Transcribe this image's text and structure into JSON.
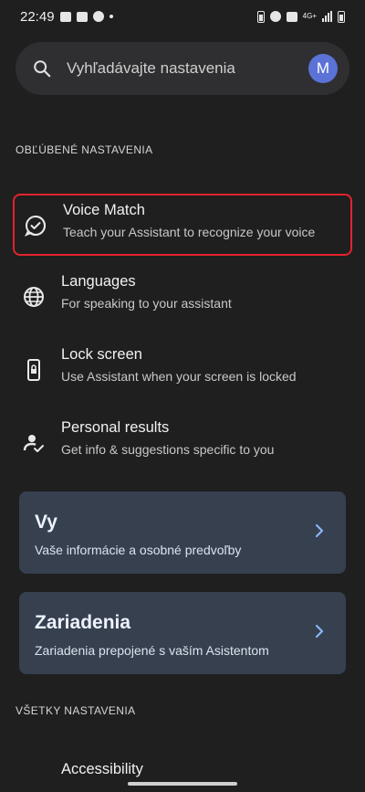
{
  "status_bar": {
    "time": "22:49",
    "network": "4G+"
  },
  "search": {
    "placeholder": "Vyhľadávajte nastavenia",
    "avatar_letter": "M"
  },
  "favorites": {
    "header": "OBĽÚBENÉ NASTAVENIA",
    "items": [
      {
        "title": "Voice Match",
        "subtitle": "Teach your Assistant to recognize your voice",
        "icon": "voice-match-icon"
      },
      {
        "title": "Languages",
        "subtitle": "For speaking to your assistant",
        "icon": "globe-icon"
      },
      {
        "title": "Lock screen",
        "subtitle": "Use Assistant when your screen is locked",
        "icon": "lock-screen-phone-icon"
      },
      {
        "title": "Personal results",
        "subtitle": "Get info & suggestions specific to you",
        "icon": "person-check-icon"
      }
    ]
  },
  "cards": [
    {
      "title": "Vy",
      "subtitle": "Vaše informácie a osobné predvoľby"
    },
    {
      "title": "Zariadenia",
      "subtitle": "Zariadenia prepojené s vaším Asistentom"
    }
  ],
  "all_settings": {
    "header": "VŠETKY NASTAVENIA",
    "first_item": "Accessibility"
  },
  "colors": {
    "background": "#1f1f1f",
    "card": "#36404f",
    "accent_chevron": "#8ab4f8",
    "highlight": "#e2232d",
    "avatar": "#5b72d6"
  }
}
